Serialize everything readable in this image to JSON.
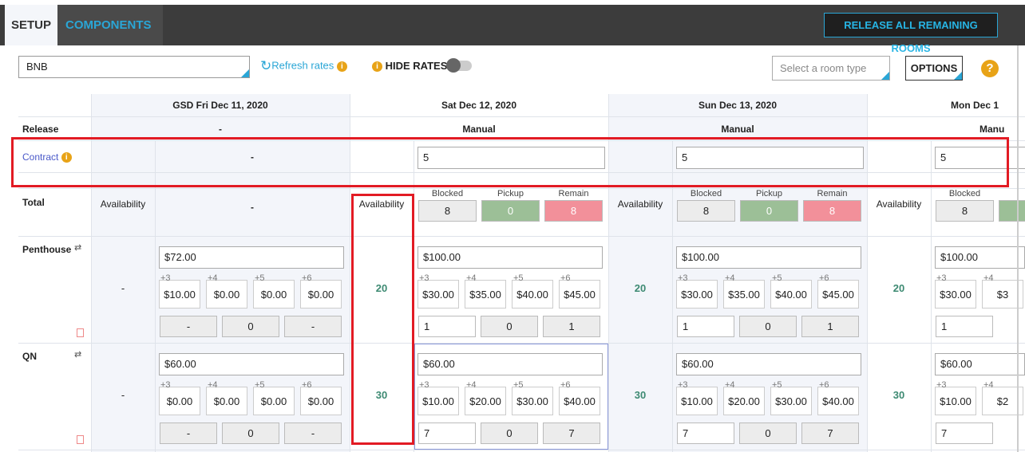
{
  "tabs": {
    "setup": "SETUP",
    "components": "COMPONENTS"
  },
  "release_all_label": "RELEASE ALL REMAINING ROOMS",
  "toolbar": {
    "property_value": "BNB",
    "refresh_label": "Refresh rates",
    "hide_rates_label": "HIDE RATES",
    "room_type_placeholder": "Select a room type",
    "options_label": "OPTIONS",
    "help_symbol": "?"
  },
  "rows": {
    "release": "Release",
    "contract": "Contract",
    "total": "Total",
    "availability": "Availability"
  },
  "days": [
    {
      "header": "GSD  Fri  Dec 11, 2020",
      "release": "-",
      "contract": "-",
      "total": "-"
    },
    {
      "header": "Sat  Dec 12, 2020",
      "release": "Manual",
      "contract": "5",
      "blocked_label": "Blocked",
      "pickup_label": "Pickup",
      "remain_label": "Remain",
      "blocked": "8",
      "pickup": "0",
      "remain": "8"
    },
    {
      "header": "Sun  Dec 13, 2020",
      "release": "Manual",
      "contract": "5",
      "blocked_label": "Blocked",
      "pickup_label": "Pickup",
      "remain_label": "Remain",
      "blocked": "8",
      "pickup": "0",
      "remain": "8"
    },
    {
      "header": "Mon  Dec 1",
      "release": "Manu",
      "contract": "5",
      "blocked_label": "Blocked",
      "blocked": "8"
    }
  ],
  "rooms": [
    {
      "name": "Penthouse",
      "day0": {
        "availability": "-",
        "rate": "$72.00",
        "extras": [
          "$10.00",
          "$0.00",
          "$0.00",
          "$0.00"
        ],
        "bottom": [
          "-",
          "0",
          "-"
        ]
      },
      "day1": {
        "availability": "20",
        "rate": "$100.00",
        "extras": [
          "$30.00",
          "$35.00",
          "$40.00",
          "$45.00"
        ],
        "bottom": [
          "1",
          "0",
          "1"
        ]
      },
      "day2": {
        "availability": "20",
        "rate": "$100.00",
        "extras": [
          "$30.00",
          "$35.00",
          "$40.00",
          "$45.00"
        ],
        "bottom": [
          "1",
          "0",
          "1"
        ]
      },
      "day3": {
        "availability": "20",
        "rate": "$100.00",
        "extras": [
          "$30.00",
          "$3"
        ],
        "bottom": [
          "1"
        ]
      }
    },
    {
      "name": "QN",
      "day0": {
        "availability": "-",
        "rate": "$60.00",
        "extras": [
          "$0.00",
          "$0.00",
          "$0.00",
          "$0.00"
        ],
        "bottom": [
          "-",
          "0",
          "-"
        ]
      },
      "day1": {
        "availability": "30",
        "rate": "$60.00",
        "extras": [
          "$10.00",
          "$20.00",
          "$30.00",
          "$40.00"
        ],
        "bottom": [
          "7",
          "0",
          "7"
        ]
      },
      "day2": {
        "availability": "30",
        "rate": "$60.00",
        "extras": [
          "$10.00",
          "$20.00",
          "$30.00",
          "$40.00"
        ],
        "bottom": [
          "7",
          "0",
          "7"
        ]
      },
      "day3": {
        "availability": "30",
        "rate": "$60.00",
        "extras": [
          "$10.00",
          "$2"
        ],
        "bottom": [
          "7"
        ]
      }
    }
  ],
  "extra_labels": [
    "+3",
    "+4",
    "+5",
    "+6"
  ]
}
